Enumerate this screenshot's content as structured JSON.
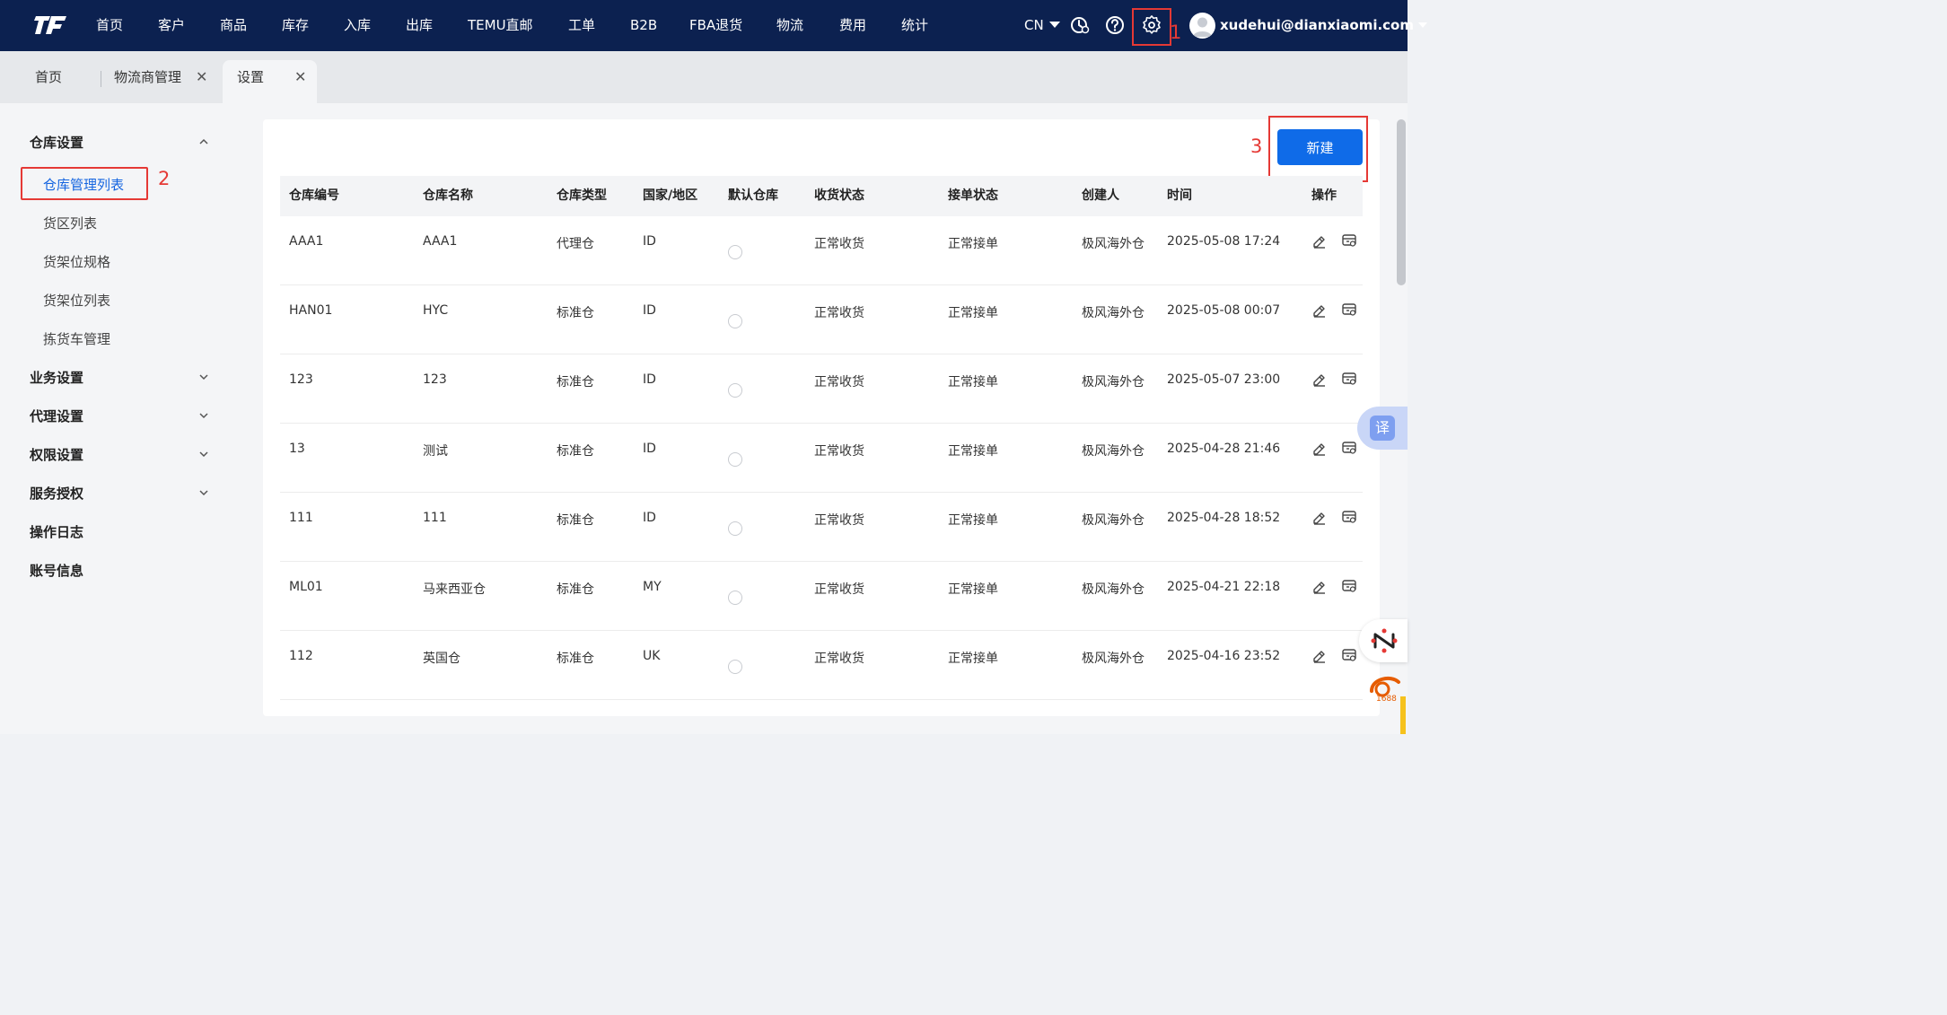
{
  "nav": {
    "items": [
      "首页",
      "客户",
      "商品",
      "库存",
      "入库",
      "出库",
      "TEMU直邮",
      "工单",
      "B2B",
      "FBA退货",
      "物流",
      "费用",
      "统计"
    ],
    "lang": "CN",
    "user_email": "xudehui@dianxiaomi.com",
    "icons": [
      "clock-icon",
      "help-icon",
      "gear-icon"
    ]
  },
  "annotations": {
    "a1": "1",
    "a2": "2",
    "a3": "3",
    "color": "#e53935"
  },
  "tabs": [
    {
      "label": "首页"
    },
    {
      "label": "物流商管理",
      "close": "✕"
    },
    {
      "label": "设置",
      "close": "✕",
      "active": true
    }
  ],
  "sidebar": {
    "warehouse_settings": {
      "label": "仓库设置",
      "items": [
        "仓库管理列表",
        "货区列表",
        "货架位规格",
        "货架位列表",
        "拣货车管理"
      ]
    },
    "sections": [
      "业务设置",
      "代理设置",
      "权限设置",
      "服务授权"
    ],
    "plain": [
      "操作日志",
      "账号信息"
    ]
  },
  "main": {
    "new_button": "新建",
    "columns": [
      "仓库编号",
      "仓库名称",
      "仓库类型",
      "国家/地区",
      "默认仓库",
      "收货状态",
      "接单状态",
      "创建人",
      "时间",
      "操作"
    ],
    "rows": [
      {
        "code": "AAA1",
        "name": "AAA1",
        "type": "代理仓",
        "country": "ID",
        "receive": "正常收货",
        "order": "正常接单",
        "creator": "极风海外仓",
        "time": "2025-05-08 17:24"
      },
      {
        "code": "HAN01",
        "name": "HYC",
        "type": "标准仓",
        "country": "ID",
        "receive": "正常收货",
        "order": "正常接单",
        "creator": "极风海外仓",
        "time": "2025-05-08 00:07"
      },
      {
        "code": "123",
        "name": "123",
        "type": "标准仓",
        "country": "ID",
        "receive": "正常收货",
        "order": "正常接单",
        "creator": "极风海外仓",
        "time": "2025-05-07 23:00"
      },
      {
        "code": "13",
        "name": "测试",
        "type": "标准仓",
        "country": "ID",
        "receive": "正常收货",
        "order": "正常接单",
        "creator": "极风海外仓",
        "time": "2025-04-28 21:46"
      },
      {
        "code": "111",
        "name": "111",
        "type": "标准仓",
        "country": "ID",
        "receive": "正常收货",
        "order": "正常接单",
        "creator": "极风海外仓",
        "time": "2025-04-28 18:52"
      },
      {
        "code": "ML01",
        "name": "马来西亚仓",
        "type": "标准仓",
        "country": "MY",
        "receive": "正常收货",
        "order": "正常接单",
        "creator": "极风海外仓",
        "time": "2025-04-21 22:18"
      },
      {
        "code": "112",
        "name": "英国仓",
        "type": "标准仓",
        "country": "UK",
        "receive": "正常收货",
        "order": "正常接单",
        "creator": "极风海外仓",
        "time": "2025-04-16 23:52"
      }
    ]
  },
  "floating": {
    "translate": "译",
    "badge_1688": "1688"
  },
  "colors": {
    "topbar": "#0c2150",
    "primary": "#0f6be8",
    "active_link": "#1565e0",
    "annotation": "#e53935"
  }
}
